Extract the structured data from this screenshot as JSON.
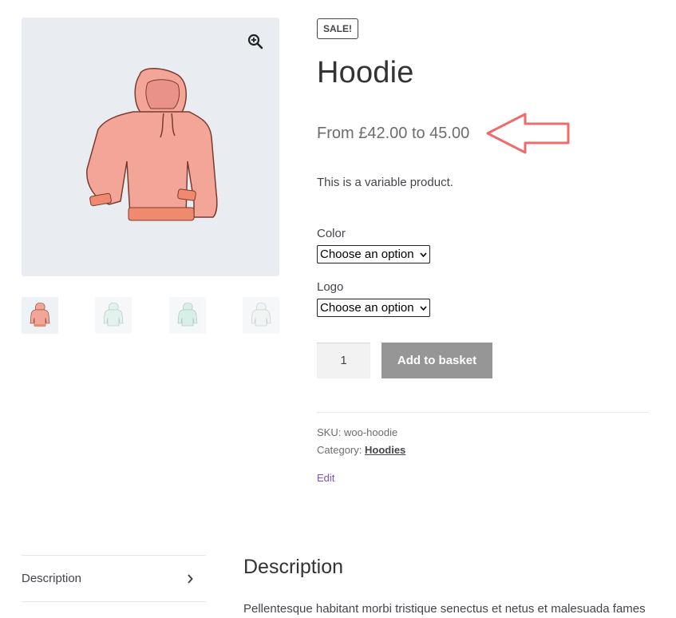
{
  "product": {
    "sale_badge": "SALE!",
    "title": "Hoodie",
    "price": "From £42.00 to 45.00",
    "short_description": "This is a variable product."
  },
  "variations": [
    {
      "label": "Color",
      "selected": "Choose an option"
    },
    {
      "label": "Logo",
      "selected": "Choose an option"
    }
  ],
  "cart": {
    "quantity": "1",
    "add_button": "Add to basket"
  },
  "meta": {
    "sku_label": "SKU:",
    "sku_value": "woo-hoodie",
    "category_label": "Category:",
    "category_value": "Hoodies",
    "edit_link": "Edit"
  },
  "tabs": {
    "items": [
      {
        "label": "Description"
      }
    ],
    "panel_title": "Description",
    "panel_text": "Pellentesque habitant morbi tristique senectus et netus et malesuada fames"
  },
  "icons": {
    "zoom": "zoom-in-icon",
    "tab_chevron": "chevron-right-icon"
  },
  "colors": {
    "annotation": "#ef6b6b",
    "edit_link": "#7f54b3",
    "button_bg": "#969696",
    "hoodie_main": "#f3a697",
    "hoodie_band": "#f08a6e"
  }
}
